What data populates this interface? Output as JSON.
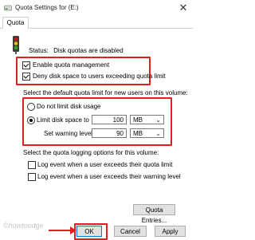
{
  "window": {
    "title": "Quota Settings for  (E:)",
    "close_glyph": "✕"
  },
  "tabs": [
    {
      "label": "Quota"
    }
  ],
  "status": {
    "label": "Status:",
    "value": "Disk quotas are disabled"
  },
  "options": {
    "enable_quota": {
      "label": "Enable quota management",
      "checked": true
    },
    "deny_space": {
      "label": "Deny disk space to users exceeding quota limit",
      "checked": true
    }
  },
  "default_limit": {
    "heading": "Select the default quota limit for new users on this volume:",
    "no_limit": {
      "label": "Do not limit disk usage",
      "selected": false
    },
    "limit": {
      "label": "Limit disk space to",
      "selected": true,
      "value": "100",
      "unit": "MB"
    },
    "warning": {
      "label": "Set warning level to",
      "value": "90",
      "unit": "MB"
    }
  },
  "logging": {
    "heading": "Select the quota logging options for this volume:",
    "log_quota": {
      "label": "Log event when a user exceeds their quota limit",
      "checked": false
    },
    "log_warning": {
      "label": "Log event when a user exceeds their warning level",
      "checked": false
    }
  },
  "buttons": {
    "entries": "Quota Entries...",
    "ok": "OK",
    "cancel": "Cancel",
    "apply": "Apply"
  },
  "watermark": "©howtoedge",
  "colors": {
    "highlight": "#e02020",
    "accent": "#0078d7"
  },
  "icons": {
    "title": "drive-quota-icon",
    "status": "traffic-light-icon"
  }
}
